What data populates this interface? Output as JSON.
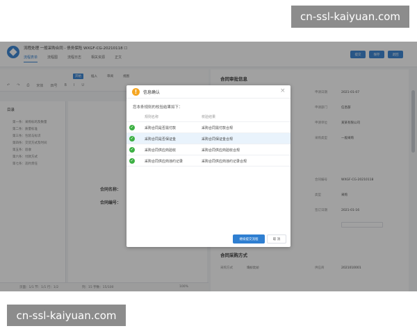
{
  "watermark": {
    "text": "cn-ssl-kaiyuan.com"
  },
  "app": {
    "title": "流程处理   一般采购合同 - 债务保险 WXGF-CG-20210118  ☐",
    "tabs": [
      "流程表单",
      "流程图",
      "流程日志",
      "相关资源",
      "正文"
    ],
    "buttons": [
      "提交",
      "保存",
      "退回"
    ]
  },
  "editor": {
    "doc_tabs": [
      "开始",
      "插入",
      "审阅",
      "视图"
    ],
    "toolbar_items": [
      "↶",
      "↷",
      "⎙",
      "宋体",
      "四号",
      "B",
      "I",
      "U"
    ],
    "outline_title": "目录",
    "outline_items": [
      "第一条：采购标的及数量",
      "第二条：质量标准",
      "第三条：包装与标识",
      "第四条：交货方式及时间",
      "第五条：验收",
      "第六条：付款方式",
      "第七条：违约责任"
    ],
    "doc_lines": [
      "合同名称：",
      "合同编号："
    ],
    "status": {
      "left": "页面：1/1   节：1/1   行：1/2",
      "mid": "列：15   字数：15/100",
      "zoom": "100%"
    }
  },
  "panel": {
    "section1": "合同审批信息",
    "fields": [
      {
        "k": "申请日期",
        "v": "2021-01-07"
      },
      {
        "k": "申请部门",
        "v": "信息部"
      },
      {
        "k": "申请单位",
        "v": "某某有限公司"
      },
      {
        "k": "采购类型",
        "v": "一般采购"
      },
      {
        "k": "合同编号",
        "v": "WXGF-CG-20210118"
      },
      {
        "k": "类型",
        "v": "采购"
      },
      {
        "k": "签订日期",
        "v": "2021-01-16"
      }
    ],
    "section2": "合同采购方式",
    "fields2": [
      {
        "k": "采购方式",
        "v": "询价比价"
      },
      {
        "k": "供应商",
        "v": "2021010001"
      }
    ]
  },
  "modal": {
    "title": "信息确认",
    "close": "×",
    "description": "您本条规则的校验结果如下：",
    "headers": {
      "rule": "规则名称",
      "result": "校验结果"
    },
    "rows": [
      {
        "rule": "采购合同是否需付款",
        "result": "采购合同需付款合规"
      },
      {
        "rule": "采购合同是否保证金",
        "result": "采购合同保证金合规"
      },
      {
        "rule": "采购合同供应商验收",
        "result": "采购合同供应商验收合规"
      },
      {
        "rule": "采购合同供应商违约记录",
        "result": "采购合同供应商违约记录合规"
      }
    ],
    "highlight_row": 1,
    "confirm_label": "继续提交流程",
    "cancel_label": "取 消"
  },
  "colors": {
    "primary": "#2f7fd1",
    "success": "#3cb043",
    "warning": "#f5a623",
    "highlight": "#e9f3fc"
  }
}
